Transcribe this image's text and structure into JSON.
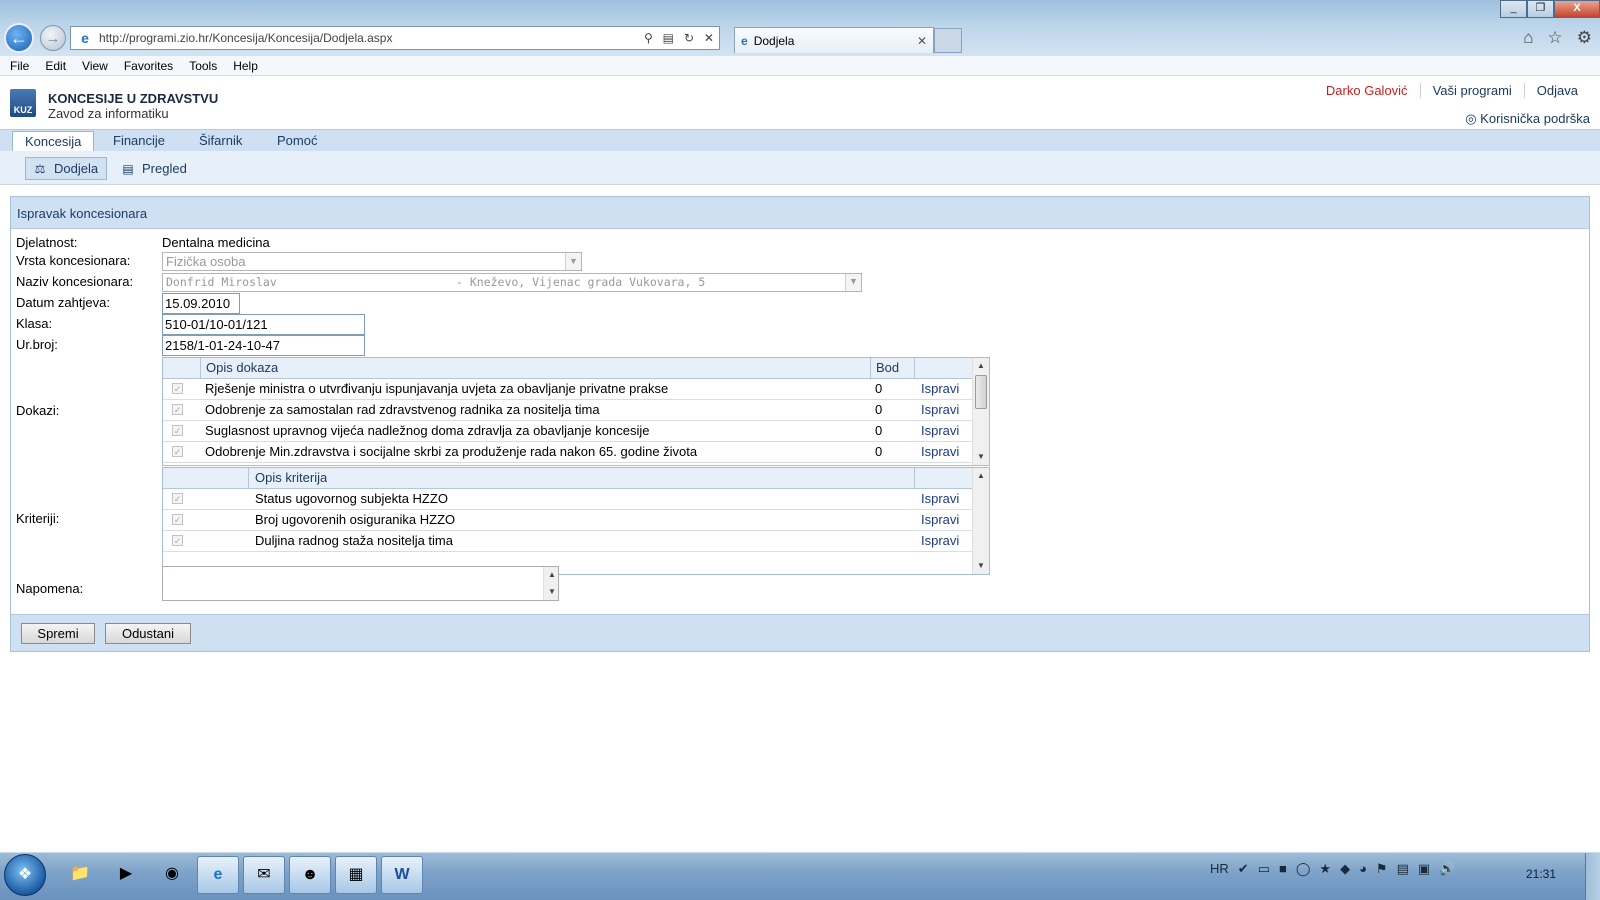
{
  "browser": {
    "url": "http://programi.zio.hr/Koncesija/Koncesija/Dodjela.aspx",
    "tab_title": "Dodjela",
    "window_controls": [
      "_",
      "❐",
      "X"
    ]
  },
  "menubar": [
    "File",
    "Edit",
    "View",
    "Favorites",
    "Tools",
    "Help"
  ],
  "app": {
    "title": "KONCESIJE U ZDRAVSTVU",
    "subtitle": "Zavod za informatiku",
    "logo_text": "KUZ",
    "user": "Darko Galović",
    "links": [
      "Vaši programi",
      "Odjava"
    ],
    "support": "Korisnička podrška"
  },
  "main_tabs": [
    "Koncesija",
    "Financije",
    "Šifarnik",
    "Pomoć"
  ],
  "sub_tabs": [
    "Dodjela",
    "Pregled"
  ],
  "form": {
    "header": "Ispravak koncesionara",
    "labels": {
      "djelatnost": "Djelatnost:",
      "vrsta": "Vrsta koncesionara:",
      "naziv": "Naziv koncesionara:",
      "datum": "Datum zahtjeva:",
      "klasa": "Klasa:",
      "urbroj": "Ur.broj:",
      "dokazi": "Dokazi:",
      "kriteriji": "Kriteriji:",
      "napomena": "Napomena:"
    },
    "djelatnost": "Dentalna medicina",
    "vrsta": "Fizička osoba",
    "naziv_name": "Donfrid Miroslav",
    "naziv_address": "- Kneževo, Vijenac grada Vukovara, 5",
    "datum": "15.09.2010",
    "klasa": "510-01/10-01/121",
    "urbroj": "2158/1-01-24-10-47",
    "napomena": "",
    "dokazi_headers": [
      "Opis dokaza",
      "Bod"
    ],
    "dokazi": [
      {
        "opis": "Rješenje ministra o utvrđivanju ispunjavanja uvjeta za obavljanje privatne prakse",
        "bod": "0",
        "action": "Ispravi"
      },
      {
        "opis": "Odobrenje za samostalan rad zdravstvenog radnika za nositelja tima",
        "bod": "0",
        "action": "Ispravi"
      },
      {
        "opis": "Suglasnost upravnog vijeća nadležnog doma zdravlja za obavljanje koncesije",
        "bod": "0",
        "action": "Ispravi"
      },
      {
        "opis": "Odobrenje Min.zdravstva i socijalne skrbi za produženje rada nakon 65. godine života",
        "bod": "0",
        "action": "Ispravi"
      }
    ],
    "kriteriji_headers": [
      "Opis kriterija"
    ],
    "kriteriji": [
      {
        "opis": "Status ugovornog subjekta HZZO",
        "action": "Ispravi"
      },
      {
        "opis": "Broj ugovorenih osiguranika HZZO",
        "action": "Ispravi"
      },
      {
        "opis": "Duljina radnog staža nositelja tima",
        "action": "Ispravi"
      }
    ],
    "buttons": {
      "save": "Spremi",
      "cancel": "Odustani"
    }
  },
  "taskbar": {
    "language": "HR",
    "clock": "21:31"
  }
}
